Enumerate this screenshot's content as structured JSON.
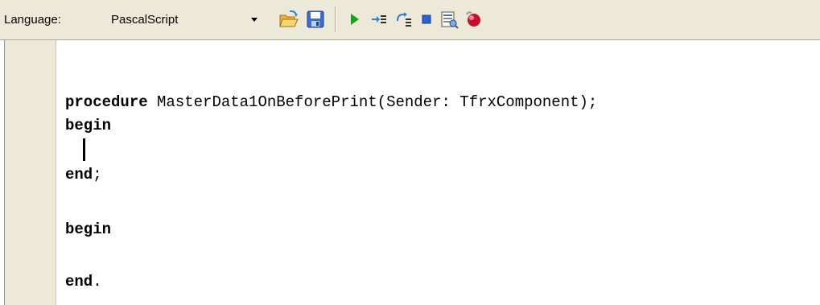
{
  "toolbar": {
    "language_label": "Language:",
    "language_select": {
      "selected": "PascalScript"
    },
    "buttons": [
      {
        "name": "open-button",
        "icon": "folder-open-icon"
      },
      {
        "name": "save-button",
        "icon": "floppy-disk-icon"
      },
      {
        "name": "run-button",
        "icon": "play-icon"
      },
      {
        "name": "step-into-button",
        "icon": "step-into-icon"
      },
      {
        "name": "step-over-button",
        "icon": "step-over-icon"
      },
      {
        "name": "stop-button",
        "icon": "stop-icon"
      },
      {
        "name": "evaluate-button",
        "icon": "evaluate-icon"
      },
      {
        "name": "breakpoint-button",
        "icon": "breakpoint-icon"
      }
    ]
  },
  "editor": {
    "lines": [
      {
        "keyword": "procedure",
        "rest": " MasterData1OnBeforePrint(Sender: TfrxComponent);"
      },
      {
        "keyword": "begin",
        "rest": ""
      },
      {
        "keyword": "",
        "rest": ""
      },
      {
        "keyword": "end",
        "rest": ";"
      },
      {
        "keyword": "",
        "rest": ""
      },
      {
        "keyword": "begin",
        "rest": ""
      },
      {
        "keyword": "",
        "rest": ""
      },
      {
        "keyword": "end",
        "rest": "."
      }
    ]
  },
  "colors": {
    "toolbar_bg": "#ece9d8",
    "gutter_bg": "#ece9d8",
    "editor_bg": "#ffffff",
    "run_green": "#19a319",
    "stop_blue": "#2c5fd8",
    "breakpoint_red": "#c8102e"
  }
}
